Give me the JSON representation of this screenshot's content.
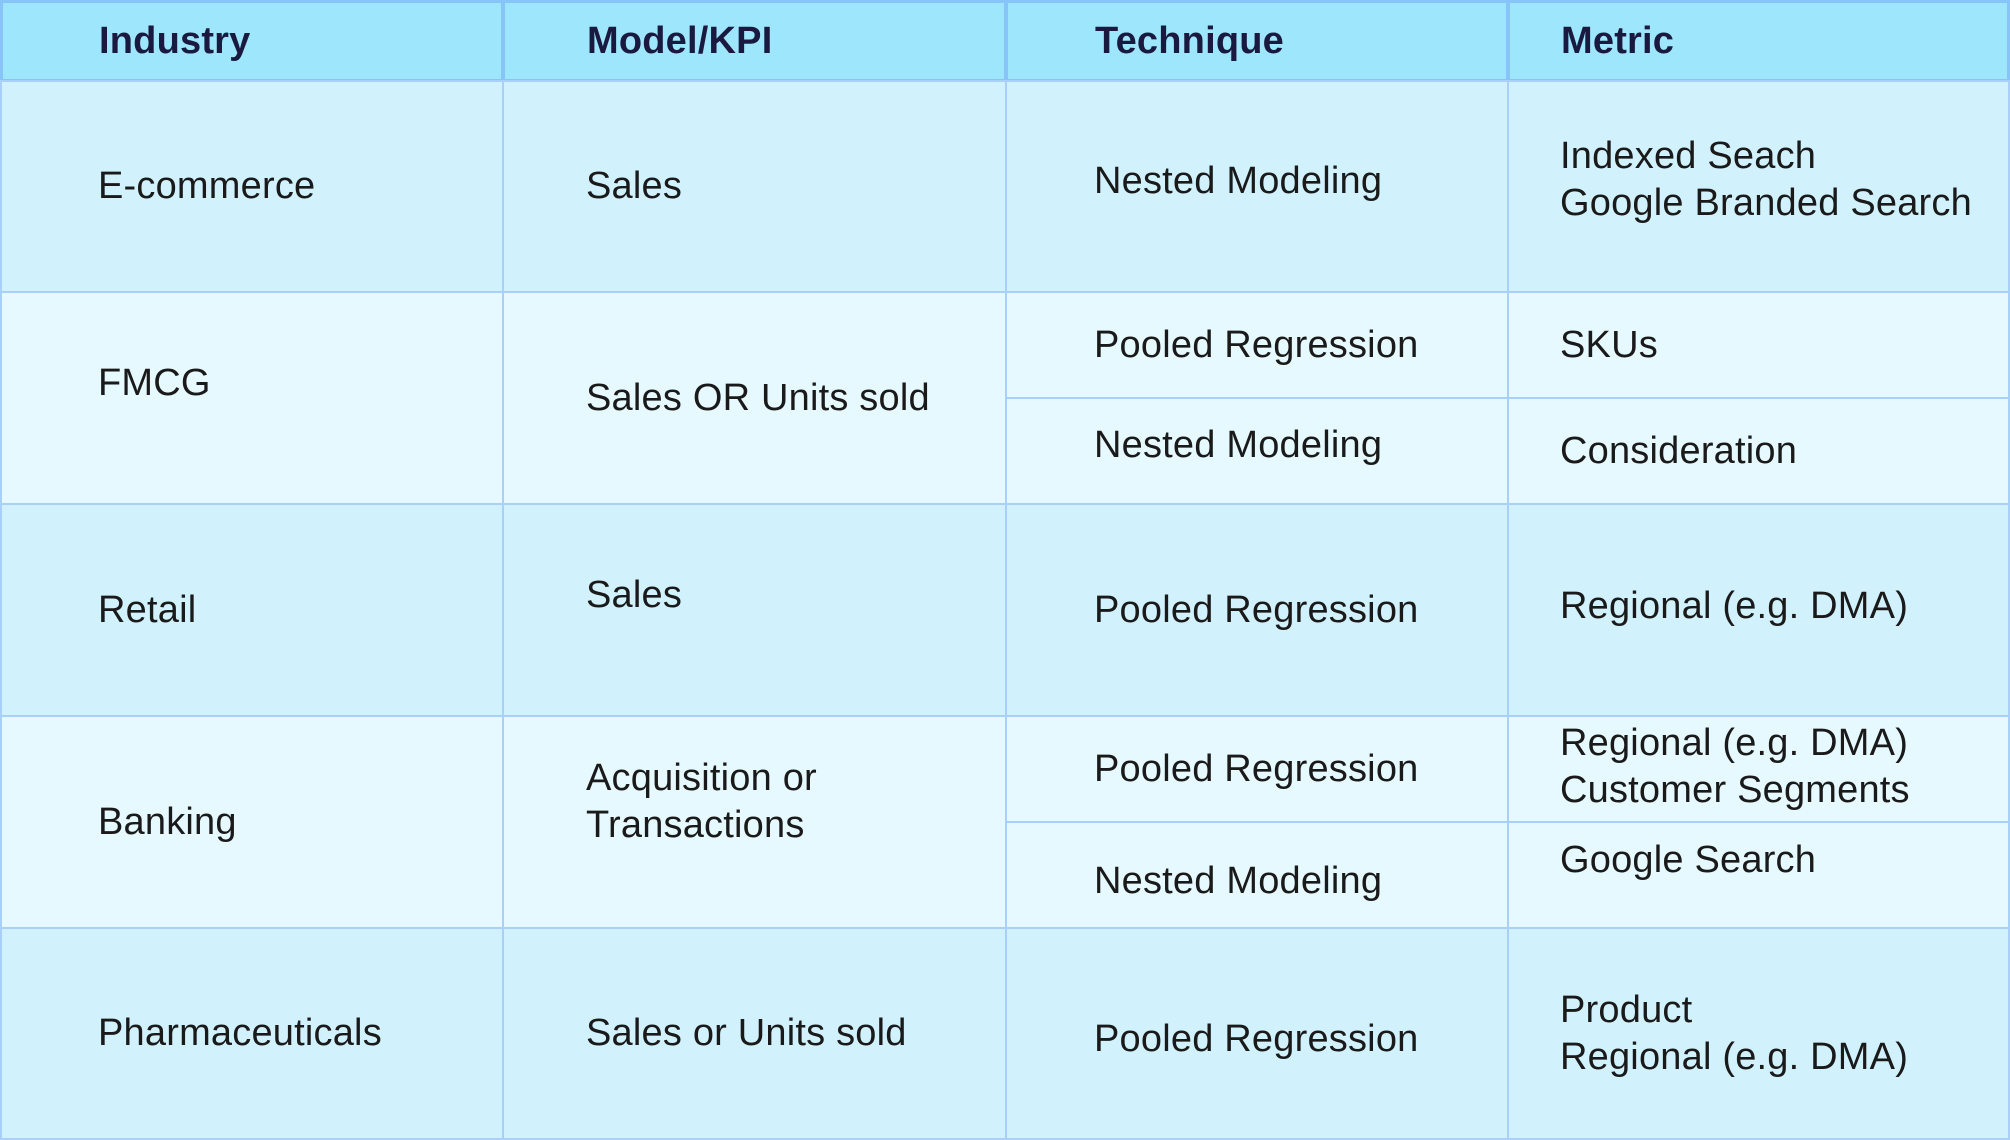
{
  "colors": {
    "header_bg": "#9ee6fb",
    "header_text": "#1a1a40",
    "row_bg_a": "#d1f2fd",
    "row_bg_b": "#e6f9fe",
    "border": "#a8d0f8",
    "text": "#1a1a1a"
  },
  "table": {
    "headers": [
      "Industry",
      "Model/KPI",
      "Technique",
      "Metric"
    ],
    "rows": [
      {
        "industry": "E-commerce",
        "kpi": [
          "Sales"
        ],
        "entries": [
          {
            "technique": "Nested Modeling",
            "metric": [
              "Indexed Seach",
              "Google Branded Search"
            ]
          }
        ]
      },
      {
        "industry": "FMCG",
        "kpi": [
          "Sales OR Units sold"
        ],
        "entries": [
          {
            "technique": "Pooled Regression",
            "metric": [
              "SKUs"
            ]
          },
          {
            "technique": "Nested Modeling",
            "metric": [
              "Consideration"
            ]
          }
        ]
      },
      {
        "industry": "Retail",
        "kpi": [
          "Sales"
        ],
        "entries": [
          {
            "technique": "Pooled Regression",
            "metric": [
              "Regional (e.g. DMA)"
            ]
          }
        ]
      },
      {
        "industry": "Banking",
        "kpi": [
          "Acquisition or",
          "Transactions"
        ],
        "entries": [
          {
            "technique": "Pooled Regression",
            "metric": [
              "Regional (e.g. DMA)",
              "Customer Segments"
            ]
          },
          {
            "technique": "Nested Modeling",
            "metric": [
              "Google Search"
            ]
          }
        ]
      },
      {
        "industry": "Pharmaceuticals",
        "kpi": [
          "Sales or Units sold"
        ],
        "entries": [
          {
            "technique": "Pooled Regression",
            "metric": [
              "Product",
              "Regional (e.g. DMA)"
            ]
          }
        ]
      }
    ]
  }
}
